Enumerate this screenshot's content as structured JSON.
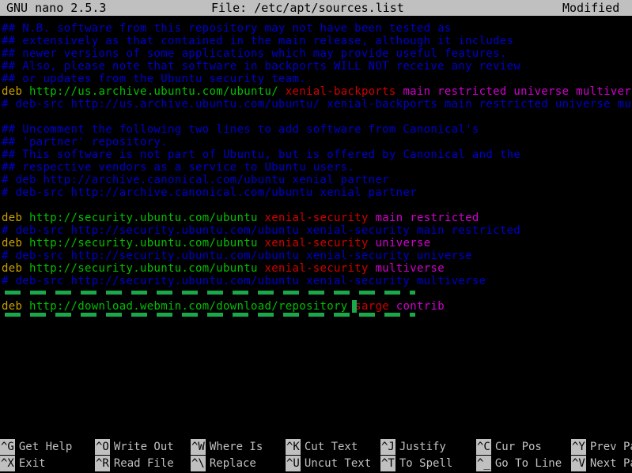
{
  "titlebar": {
    "version": "GNU nano 2.5.3",
    "file": "File: /etc/apt/sources.list",
    "status": "Modified"
  },
  "colors": {
    "title_bg": "#c0c0c0",
    "title_fg": "#000000",
    "background": "#000000",
    "comment": "#0000cc",
    "keyword": "#c8a000",
    "url": "#00c000",
    "distribution": "#d00000",
    "components": "#d000d0",
    "selection": "#1aa84a",
    "shortcut_fg": "#c0c0c0"
  },
  "editor": {
    "lines": [
      {
        "row": 0,
        "segments": [
          {
            "text": "## N.B. software from this repository may not have been tested as",
            "color": "comment"
          }
        ]
      },
      {
        "row": 1,
        "segments": [
          {
            "text": "## extensively as that contained in the main release, although it includes",
            "color": "comment"
          }
        ]
      },
      {
        "row": 2,
        "segments": [
          {
            "text": "## newer versions of some applications which may provide useful features.",
            "color": "comment"
          }
        ]
      },
      {
        "row": 3,
        "segments": [
          {
            "text": "## Also, please note that software in backports WILL NOT receive any review",
            "color": "comment"
          }
        ]
      },
      {
        "row": 4,
        "segments": [
          {
            "text": "## or updates from the Ubuntu security team.",
            "color": "comment"
          }
        ]
      },
      {
        "row": 5,
        "segments": [
          {
            "text": "deb ",
            "color": "keyword"
          },
          {
            "text": "http://us.archive.ubuntu.com/ubuntu/ ",
            "color": "url"
          },
          {
            "text": "xenial-backports ",
            "color": "distribution"
          },
          {
            "text": "main restricted universe multiverse",
            "color": "components"
          }
        ]
      },
      {
        "row": 6,
        "segments": [
          {
            "text": "# deb-src http://us.archive.ubuntu.com/ubuntu/ xenial-backports main restricted universe multiverse",
            "color": "comment"
          }
        ]
      },
      {
        "row": 7,
        "segments": []
      },
      {
        "row": 8,
        "segments": [
          {
            "text": "## Uncomment the following two lines to add software from Canonical's",
            "color": "comment"
          }
        ]
      },
      {
        "row": 9,
        "segments": [
          {
            "text": "## 'partner' repository.",
            "color": "comment"
          }
        ]
      },
      {
        "row": 10,
        "segments": [
          {
            "text": "## This software is not part of Ubuntu, but is offered by Canonical and the",
            "color": "comment"
          }
        ]
      },
      {
        "row": 11,
        "segments": [
          {
            "text": "## respective vendors as a service to Ubuntu users.",
            "color": "comment"
          }
        ]
      },
      {
        "row": 12,
        "segments": [
          {
            "text": "# deb http://archive.canonical.com/ubuntu xenial partner",
            "color": "comment"
          }
        ]
      },
      {
        "row": 13,
        "segments": [
          {
            "text": "# deb-src http://archive.canonical.com/ubuntu xenial partner",
            "color": "comment"
          }
        ]
      },
      {
        "row": 14,
        "segments": []
      },
      {
        "row": 15,
        "segments": [
          {
            "text": "deb ",
            "color": "keyword"
          },
          {
            "text": "http://security.ubuntu.com/ubuntu ",
            "color": "url"
          },
          {
            "text": "xenial-security ",
            "color": "distribution"
          },
          {
            "text": "main restricted",
            "color": "components"
          }
        ]
      },
      {
        "row": 16,
        "segments": [
          {
            "text": "# deb-src http://security.ubuntu.com/ubuntu xenial-security main restricted",
            "color": "comment"
          }
        ]
      },
      {
        "row": 17,
        "segments": [
          {
            "text": "deb ",
            "color": "keyword"
          },
          {
            "text": "http://security.ubuntu.com/ubuntu ",
            "color": "url"
          },
          {
            "text": "xenial-security ",
            "color": "distribution"
          },
          {
            "text": "universe",
            "color": "components"
          }
        ]
      },
      {
        "row": 18,
        "segments": [
          {
            "text": "# deb-src http://security.ubuntu.com/ubuntu xenial-security universe",
            "color": "comment"
          }
        ]
      },
      {
        "row": 19,
        "segments": [
          {
            "text": "deb ",
            "color": "keyword"
          },
          {
            "text": "http://security.ubuntu.com/ubuntu ",
            "color": "url"
          },
          {
            "text": "xenial-security ",
            "color": "distribution"
          },
          {
            "text": "multiverse",
            "color": "components"
          }
        ]
      },
      {
        "row": 20,
        "segments": [
          {
            "text": "# deb-src http://security.ubuntu.com/ubuntu xenial-security multiverse",
            "color": "comment"
          }
        ]
      },
      {
        "row": 21,
        "segments": []
      },
      {
        "row": 22,
        "segments": [
          {
            "text": "deb ",
            "color": "keyword"
          },
          {
            "text": "http://download.webmin.com/download/repository ",
            "color": "url"
          },
          {
            "text": "sarge ",
            "color": "distribution"
          },
          {
            "text": "contrib",
            "color": "components"
          }
        ]
      }
    ],
    "highlighted_row": 22,
    "cursor": {
      "row": 22,
      "column": 55
    }
  },
  "shortcuts": [
    {
      "key": "^G",
      "label": "Get Help",
      "col": 0,
      "line": 0
    },
    {
      "key": "^X",
      "label": "Exit",
      "col": 0,
      "line": 1
    },
    {
      "key": "^O",
      "label": "Write Out",
      "col": 15,
      "line": 0
    },
    {
      "key": "^R",
      "label": "Read File",
      "col": 15,
      "line": 1
    },
    {
      "key": "^W",
      "label": "Where Is",
      "col": 30,
      "line": 0
    },
    {
      "key": "^\\",
      "label": "Replace",
      "col": 30,
      "line": 1
    },
    {
      "key": "^K",
      "label": "Cut Text",
      "col": 45,
      "line": 0
    },
    {
      "key": "^U",
      "label": "Uncut Text",
      "col": 45,
      "line": 1
    },
    {
      "key": "^J",
      "label": "Justify",
      "col": 60,
      "line": 0
    },
    {
      "key": "^T",
      "label": "To Spell",
      "col": 60,
      "line": 1
    },
    {
      "key": "^C",
      "label": "Cur Pos",
      "col": 75,
      "line": 0
    },
    {
      "key": "^_",
      "label": "Go To Line",
      "col": 75,
      "line": 1
    },
    {
      "key": "^Y",
      "label": "Prev Page",
      "col": 90,
      "line": 0
    },
    {
      "key": "^V",
      "label": "Next Page",
      "col": 90,
      "line": 1
    }
  ]
}
